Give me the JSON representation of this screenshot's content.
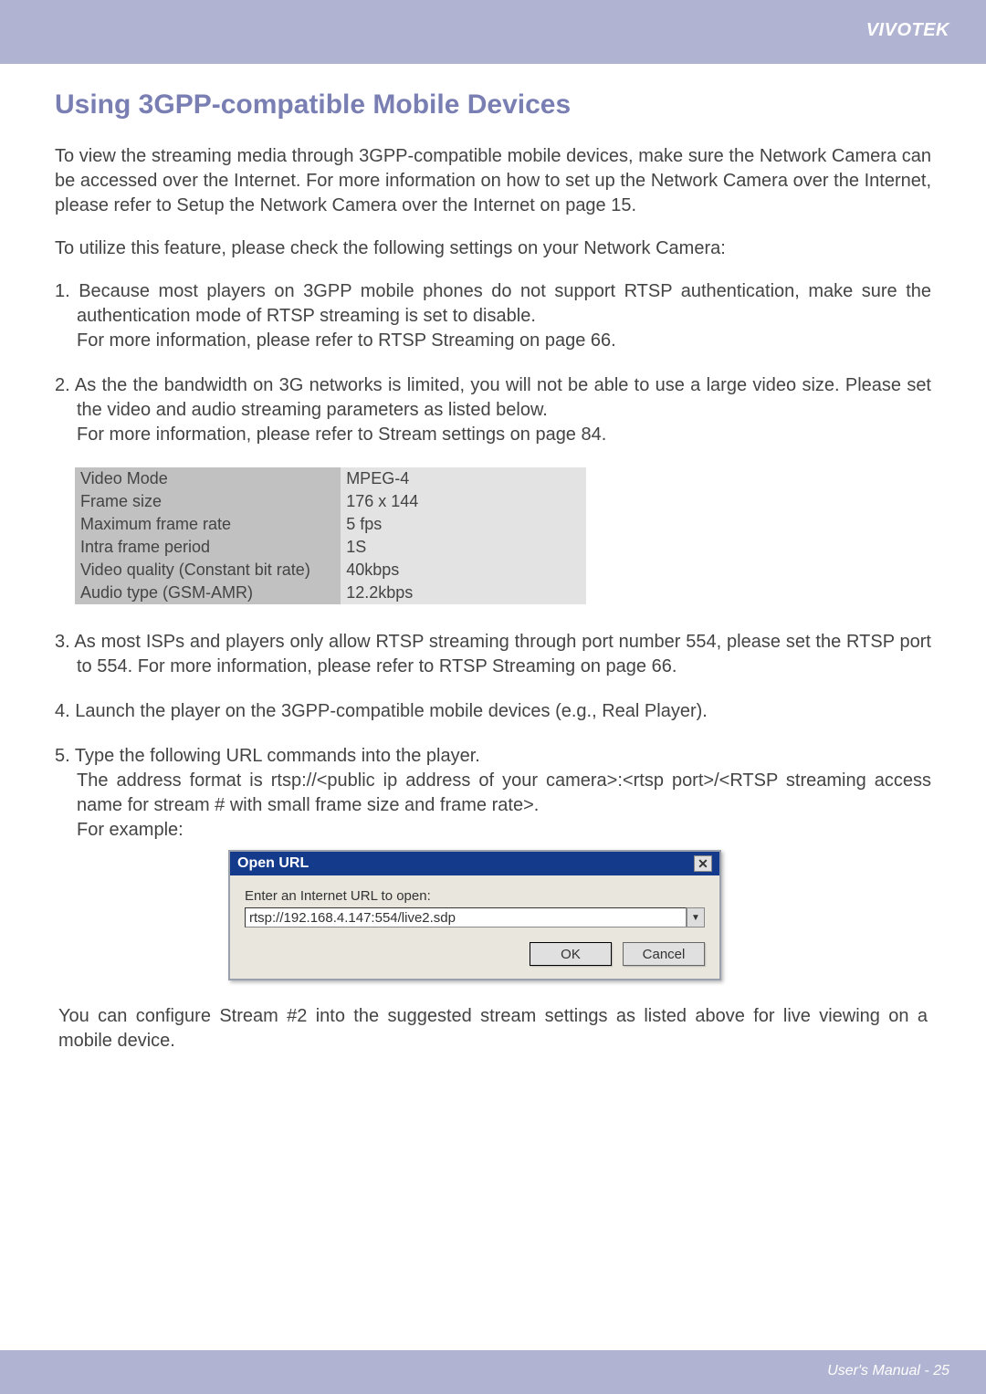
{
  "header": {
    "brand": "VIVOTEK"
  },
  "title": "Using 3GPP-compatible Mobile Devices",
  "para_intro": "To view the streaming media through 3GPP-compatible mobile devices, make sure the Network Camera can be accessed over the Internet. For more information on how to set up the Network Camera over the Internet, please refer to Setup the Network Camera over the Internet on page 15.",
  "para_utilize": "To utilize this feature, please check the following settings on your Network Camera:",
  "item1": "1. Because most players on 3GPP mobile phones do not support RTSP authentication, make sure the authentication mode of RTSP streaming is set to disable.\nFor more information, please refer to RTSP Streaming on page 66.",
  "item2": "2. As the the bandwidth on 3G networks is limited, you will not be able to use a large video size. Please set the video and audio streaming parameters as listed below.\nFor more information, please refer to Stream settings on page 84.",
  "settings": [
    {
      "label": "Video Mode",
      "value": "MPEG-4"
    },
    {
      "label": "Frame size",
      "value": "176 x 144"
    },
    {
      "label": "Maximum frame rate",
      "value": "5 fps"
    },
    {
      "label": "Intra frame period",
      "value": "1S"
    },
    {
      "label": "Video quality (Constant bit rate)",
      "value": "40kbps"
    },
    {
      "label": "Audio type (GSM-AMR)",
      "value": "12.2kbps"
    }
  ],
  "item3": "3. As most ISPs and players only allow RTSP streaming through port number 554, please set the RTSP port to 554. For more information, please refer to RTSP Streaming on page 66.",
  "item4": "4. Launch the player on the 3GPP-compatible mobile devices (e.g., Real Player).",
  "item5": "5. Type the following URL commands into the player.\nThe address format is rtsp://<public ip address of your camera>:<rtsp port>/<RTSP streaming access name for stream # with small frame size and frame rate>.\nFor example:",
  "dialog": {
    "title": "Open URL",
    "close": "✕",
    "label": "Enter an Internet URL to open:",
    "url": "rtsp://192.168.4.147:554/live2.sdp",
    "dropdown_glyph": "▼",
    "ok": "OK",
    "cancel": "Cancel"
  },
  "para_config": "You can configure Stream #2 into the suggested stream settings as listed above for live viewing on a mobile device.",
  "footer": {
    "page": "User's Manual - 25"
  }
}
